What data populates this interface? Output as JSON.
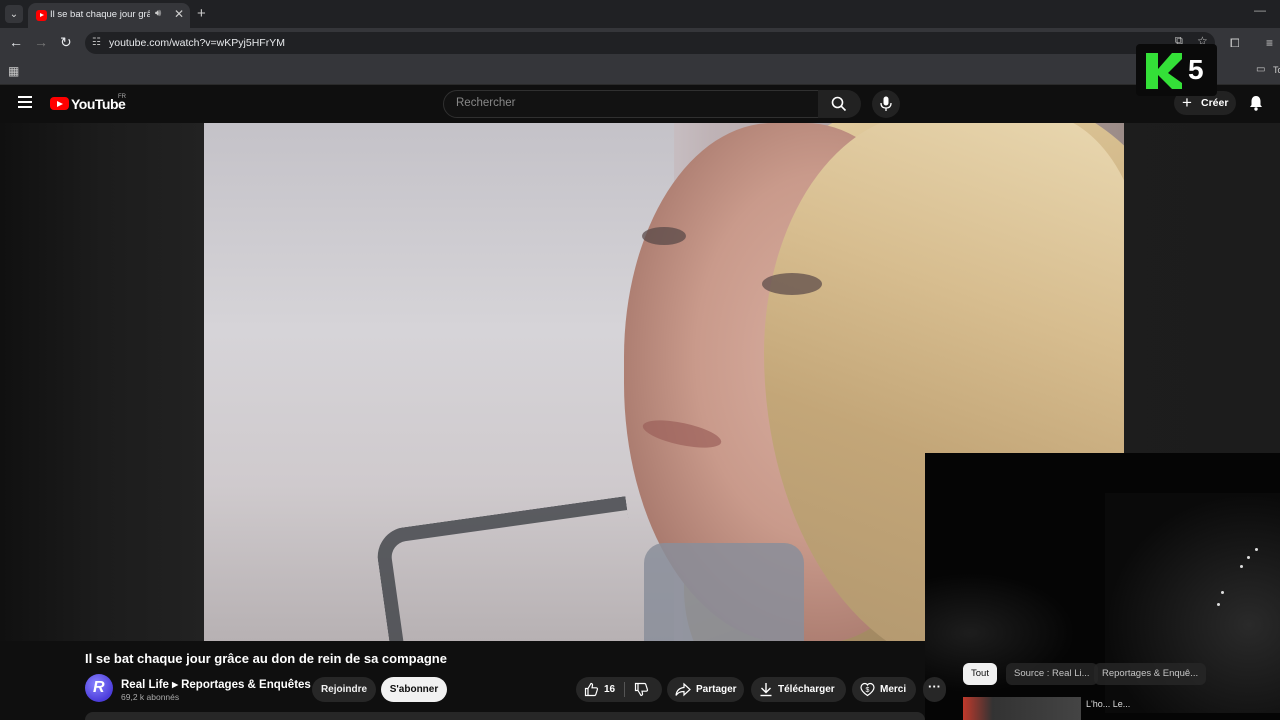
{
  "browser": {
    "tab_title": "Il se bat chaque jour grâce au don de rein de sa compagne",
    "url": "youtube.com/watch?v=wKPyj5HFrYM",
    "bookmark_label": "To"
  },
  "overlay": {
    "channel_number": "5"
  },
  "youtube": {
    "logo_text": "YouTube",
    "country_code": "FR",
    "search_placeholder": "Rechercher",
    "create_label": "Créer"
  },
  "video": {
    "title": "Il se bat chaque jour grâce au don de rein de sa compagne",
    "channel_name": "Real Life ▸ Reportages & Enquêtes",
    "channel_avatar_letter": "R",
    "subscribers": "69,2 k abonnés",
    "join_label": "Rejoindre",
    "subscribe_label": "S'abonner",
    "likes": "16",
    "share_label": "Partager",
    "download_label": "Télécharger",
    "thanks_label": "Merci",
    "more_label": "···"
  },
  "recommendations": {
    "chips": [
      "Tout",
      "Source : Real Li...",
      "Reportages & Enquê..."
    ],
    "first_item_partial": "L'ho... Le..."
  },
  "colors": {
    "youtube_red": "#ff0000",
    "background": "#0f0f0f",
    "k5_green": "#34e038"
  }
}
